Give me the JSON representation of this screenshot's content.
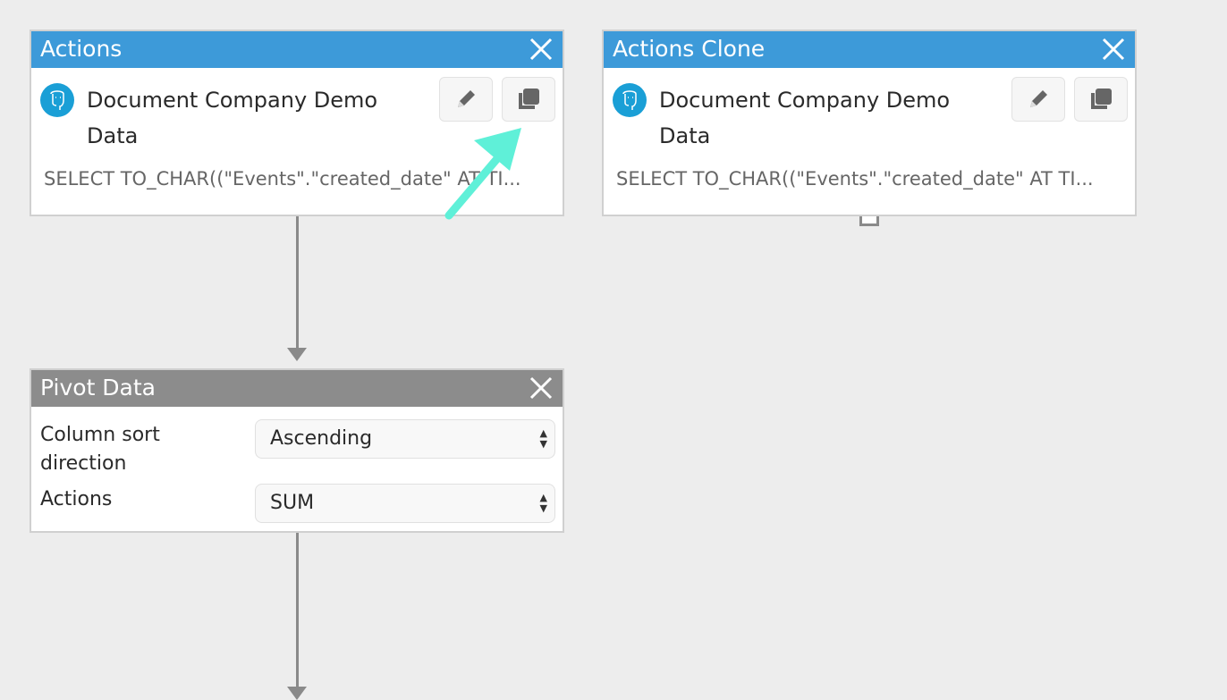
{
  "cards": [
    {
      "title": "Actions",
      "source": "Document Company Demo Data",
      "sql": "SELECT TO_CHAR((\"Events\".\"created_date\" AT TI...",
      "header_color": "#3d9ad9"
    },
    {
      "title": "Actions Clone",
      "source": "Document Company Demo Data",
      "sql": "SELECT TO_CHAR((\"Events\".\"created_date\" AT TI...",
      "header_color": "#3d9ad9"
    }
  ],
  "pivot": {
    "title": "Pivot Data",
    "header_color": "#8c8c8c",
    "fields": [
      {
        "label": "Column sort direction",
        "value": "Ascending"
      },
      {
        "label": "Actions",
        "value": "SUM"
      }
    ]
  },
  "annotation": {
    "icon": "arrow-pointing-to-clone-button",
    "color": "#5ff0d8"
  }
}
